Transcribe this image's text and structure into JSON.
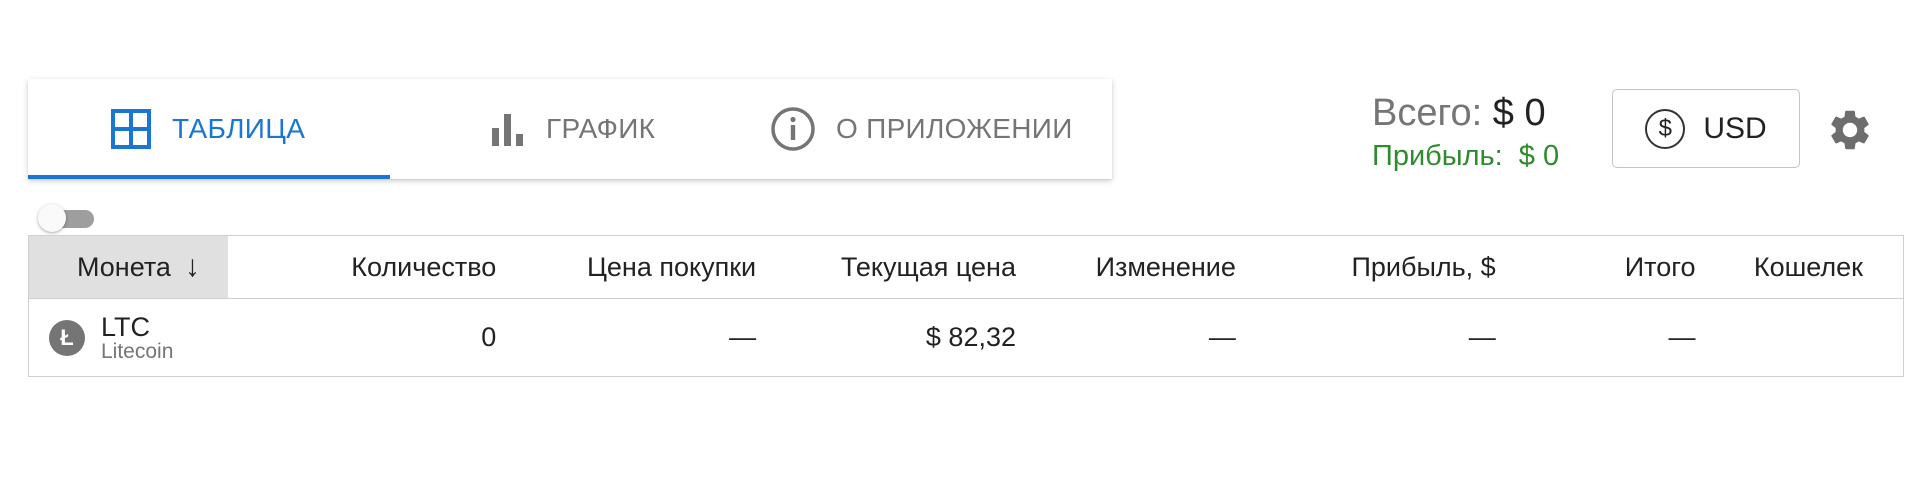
{
  "tabs": [
    {
      "label": "ТАБЛИЦА",
      "icon": "grid-icon",
      "active": true
    },
    {
      "label": "ГРАФИК",
      "icon": "bar-chart-icon",
      "active": false
    },
    {
      "label": "О ПРИЛОЖЕНИИ",
      "icon": "info-icon",
      "active": false
    }
  ],
  "totals": {
    "total_label": "Всего:",
    "total_value": "$ 0",
    "profit_label": "Прибыль:",
    "profit_value": "$ 0"
  },
  "currency": {
    "icon": "dollar-coin-icon",
    "symbol": "$",
    "label": "USD"
  },
  "settings_icon": "gear-icon",
  "toggle": {
    "on": false
  },
  "table": {
    "columns": {
      "coin": "Монета",
      "sort_arrow": "↓",
      "quantity": "Количество",
      "buy_price": "Цена покупки",
      "current_price": "Текущая цена",
      "change": "Изменение",
      "profit": "Прибыль, $",
      "total": "Итого",
      "wallet": "Кошелек"
    },
    "rows": [
      {
        "icon": "litecoin-icon",
        "logo_glyph": "Ł",
        "symbol": "LTC",
        "name": "Litecoin",
        "quantity": "0",
        "buy_price": "—",
        "current_price": "$ 82,32",
        "change": "—",
        "profit": "—",
        "total": "—",
        "wallet": ""
      }
    ]
  },
  "colors": {
    "accent": "#1976d2",
    "profit": "#2e8b2e",
    "muted": "#757575",
    "sorted_header_bg": "#e0e0e0",
    "border": "#cfcfcf"
  }
}
